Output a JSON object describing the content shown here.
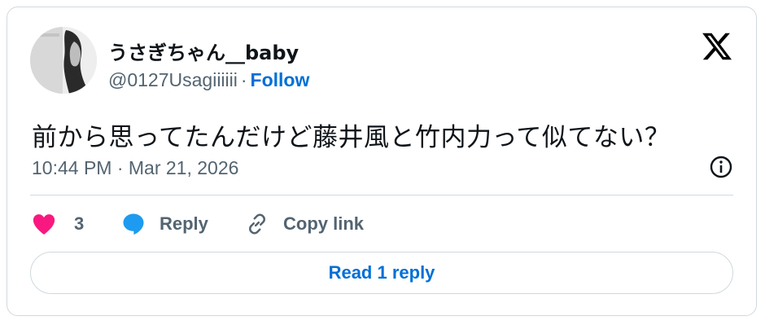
{
  "tweet": {
    "display_name": "うさぎちゃん__baby",
    "handle": "@0127Usagiiiiii",
    "separator": "·",
    "follow_label": "Follow",
    "text": "前から思ってたんだけど藤井風と竹内力って似てない？",
    "timestamp": "10:44 PM · Mar 21, 2026"
  },
  "actions": {
    "like_count": "3",
    "reply_label": "Reply",
    "copy_link_label": "Copy link"
  },
  "footer": {
    "read_replies_label": "Read 1 reply"
  },
  "colors": {
    "accent": "#006fd6",
    "like": "#f91880",
    "reply_icon": "#1d9bf0",
    "muted": "#536471",
    "border": "#cfd9de"
  },
  "icons": {
    "brand": "x-logo-icon",
    "like": "heart-icon",
    "reply": "speech-bubble-icon",
    "copy": "link-icon",
    "info": "info-icon"
  }
}
